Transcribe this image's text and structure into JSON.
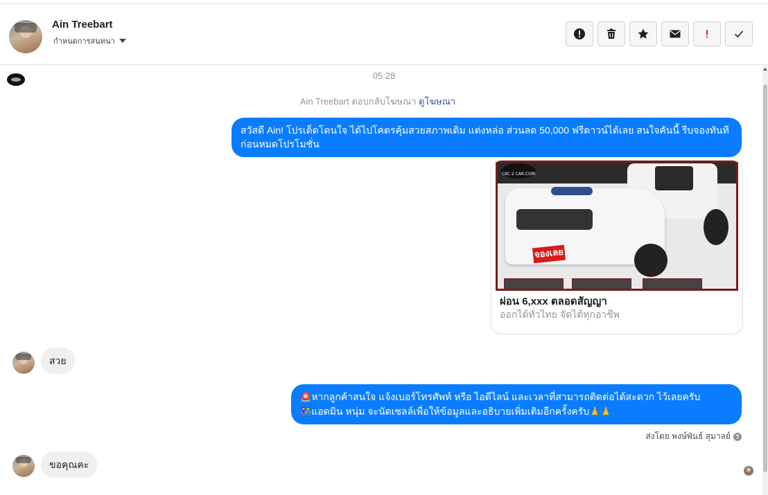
{
  "header": {
    "contact_name": "Ain Treebart",
    "assign_label": "กำหนดการสนทนา",
    "actions": [
      {
        "name": "spam",
        "icon": "exclamation-circle-icon"
      },
      {
        "name": "delete",
        "icon": "trash-icon"
      },
      {
        "name": "star",
        "icon": "star-icon"
      },
      {
        "name": "mark-unread",
        "icon": "envelope-icon"
      },
      {
        "name": "follow-up",
        "icon": "red-exclamation-icon"
      },
      {
        "name": "done",
        "icon": "check-icon"
      }
    ]
  },
  "conversation": {
    "timestamp": "05:28",
    "reply_note": "Ain Treebart ตอบกลับโฆษณา",
    "reply_link": "ดูโฆษณา",
    "message1": "สวัสดี Ain! โปรเด็ดโดนใจ ได้ไปโคตรคุ้มสวยสภาพเดิม แต่งหล่อ  ส่วนลด 50,000 ฟรีดาวน์ได้เลย  สนใจคันนี้ รีบจองทันทีก่อนหมดโปรโมชั่น",
    "ad_card": {
      "image_stamp": "จองเลย",
      "image_logo": "CKC 2 CAR.COM",
      "title": "ผ่อน 6,xxx ตลอดสัญญา",
      "subtitle": "ออกได้ทั่วไทย จัดได้ทุกอาชีพ"
    },
    "reply1": "สวย",
    "message2_line1": "หากลูกค้าสนใจ แจ้งเบอร์โทรศัพท์ หรือ ไอดีไลน์ และเวลาที่สามารถติดต่อได้สะดวก ไว้เลยครับ",
    "message2_line2": "แอดมิน หนุ่ม จะนัดเซลล์เพื่อให้ข้อมูลและอธิบายเพิ่มเติมอีกครั้งครับ",
    "sent_by": "ส่งโดย พงษ์พันธ์ สุมาลย์",
    "reply2": "ขอคุณคะ"
  },
  "colors": {
    "outgoing_bubble": "#0a7cff",
    "incoming_bubble": "#f1f0f0",
    "link": "#365899"
  }
}
